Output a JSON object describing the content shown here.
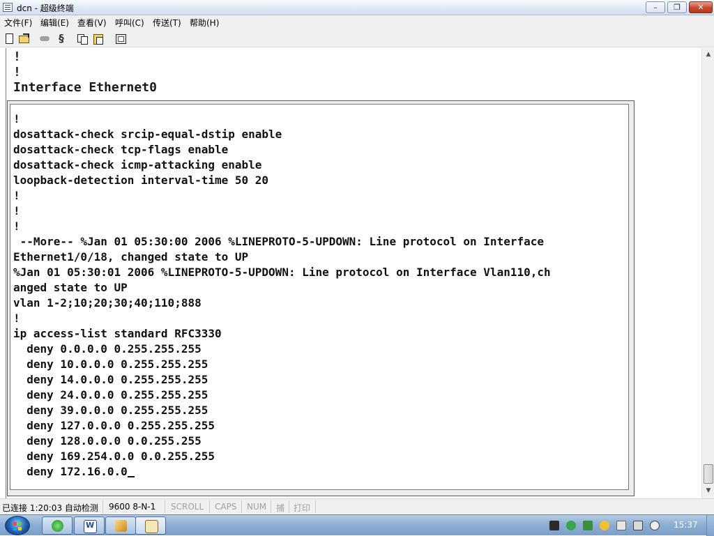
{
  "window": {
    "title": "dcn - 超级终端",
    "min_label": "–",
    "max_label": "❐",
    "close_label": "✕"
  },
  "menu": [
    "文件(F)",
    "编辑(E)",
    "查看(V)",
    "呼叫(C)",
    "传送(T)",
    "帮助(H)"
  ],
  "toolbar": {
    "icons": [
      "new-file-icon",
      "open-folder-icon",
      "hang-up-icon",
      "properties-icon",
      "copy-icon",
      "paste-icon",
      "settings-icon"
    ]
  },
  "terminal": {
    "lines": [
      "!",
      "!",
      "Interface Ethernet0"
    ]
  },
  "inner_terminal": {
    "lines": [
      "!",
      "dosattack-check srcip-equal-dstip enable",
      "dosattack-check tcp-flags enable",
      "dosattack-check icmp-attacking enable",
      "loopback-detection interval-time 50 20",
      "!",
      "!",
      "!",
      " --More-- %Jan 01 05:30:00 2006 %LINEPROTO-5-UPDOWN: Line protocol on Interface",
      "Ethernet1/0/18, changed state to UP",
      "%Jan 01 05:30:01 2006 %LINEPROTO-5-UPDOWN: Line protocol on Interface Vlan110,ch",
      "anged state to UP",
      "vlan 1-2;10;20;30;40;110;888",
      "!",
      "ip access-list standard RFC3330",
      "  deny 0.0.0.0 0.255.255.255",
      "  deny 10.0.0.0 0.255.255.255",
      "  deny 14.0.0.0 0.255.255.255",
      "  deny 24.0.0.0 0.255.255.255",
      "  deny 39.0.0.0 0.255.255.255",
      "  deny 127.0.0.0 0.255.255.255",
      "  deny 128.0.0.0 0.0.255.255",
      "  deny 169.254.0.0 0.0.255.255",
      "  deny 172.16.0.0"
    ]
  },
  "statusbar": {
    "connection": "已连接 1:20:03 自动检测",
    "settings": "9600 8-N-1",
    "scroll": "SCROLL",
    "caps": "CAPS",
    "num": "NUM",
    "capture": "捕",
    "print": "打印"
  },
  "taskbar": {
    "clock": "15:37",
    "apps": [
      "internet-explorer-icon",
      "word-icon",
      "app-icon",
      "hyperterminal-icon"
    ]
  },
  "colors": {
    "terminal_text": "#1a1a1a",
    "taskbar_blue": "#8eafd3",
    "status_dim": "#a0a0a0"
  }
}
